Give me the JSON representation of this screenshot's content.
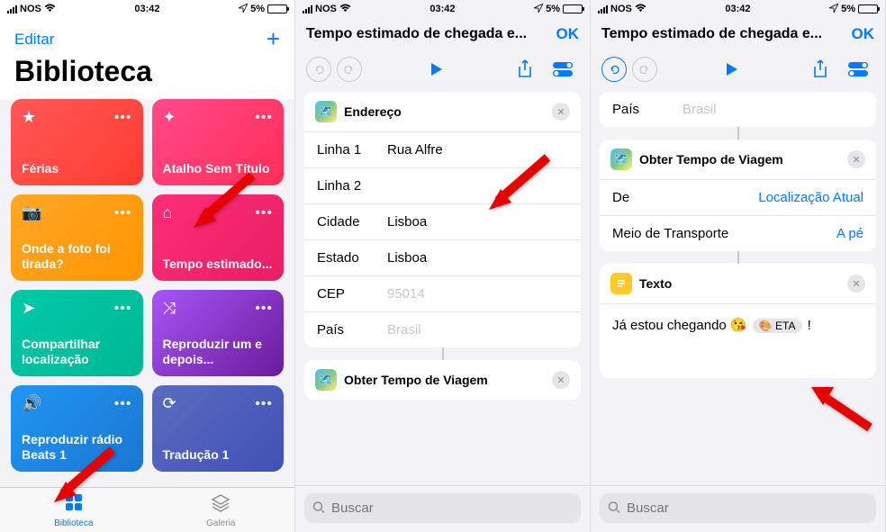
{
  "status": {
    "carrier": "NOS",
    "time": "03:42",
    "battery_pct": "5%"
  },
  "s1": {
    "edit": "Editar",
    "title": "Biblioteca",
    "cards": [
      {
        "label": "Férias",
        "icon": "★"
      },
      {
        "label": "Atalho Sem Título",
        "icon": "✦"
      },
      {
        "label": "Onde a foto foi tirada?",
        "icon": "📷"
      },
      {
        "label": "Tempo estimado...",
        "icon": "⌂"
      },
      {
        "label": "Compartilhar localização",
        "icon": "➤"
      },
      {
        "label": "Reproduzir um e depois...",
        "icon": "⤨"
      },
      {
        "label": "Reproduzir rádio Beats 1",
        "icon": "🔊"
      },
      {
        "label": "Tradução 1",
        "icon": "⟳"
      }
    ],
    "tabs": {
      "lib": "Biblioteca",
      "gal": "Galeria"
    }
  },
  "s2": {
    "nav_title": "Tempo estimado de chegada e...",
    "ok": "OK",
    "block_addr": "Endereço",
    "rows": {
      "linha1_l": "Linha 1",
      "linha1_v": "Rua Alfre",
      "linha2_l": "Linha 2",
      "linha2_v": "",
      "cidade_l": "Cidade",
      "cidade_v": "Lisboa",
      "estado_l": "Estado",
      "estado_v": "Lisboa",
      "cep_l": "CEP",
      "cep_v": "95014",
      "pais_l": "País",
      "pais_v": "Brasil"
    },
    "block_travel": "Obter Tempo de Viagem",
    "search": "Buscar"
  },
  "s3": {
    "nav_title": "Tempo estimado de chegada e...",
    "ok": "OK",
    "pais_l": "País",
    "pais_v": "Brasil",
    "block_travel": "Obter Tempo de Viagem",
    "de_l": "De",
    "de_v": "Localização Atual",
    "meio_l": "Meio de Transporte",
    "meio_v": "A pé",
    "block_text": "Texto",
    "text_body": "Já estou chegando 😘 ",
    "eta_label": "🎨 ETA",
    "text_suffix": " !",
    "search": "Buscar"
  }
}
